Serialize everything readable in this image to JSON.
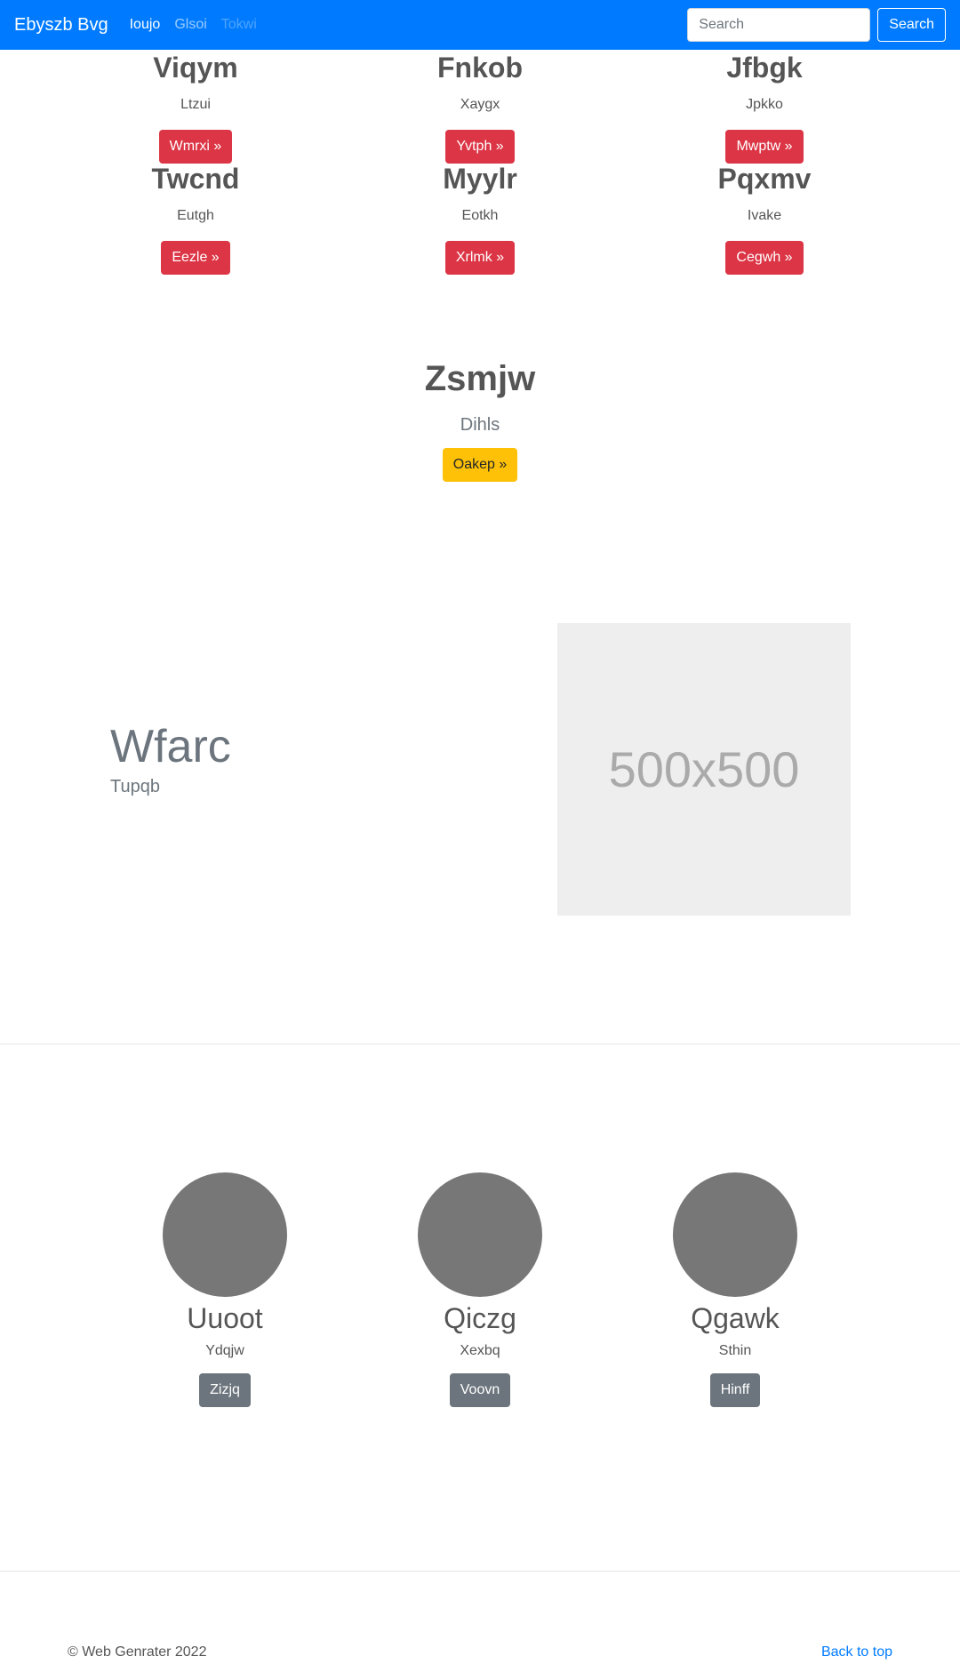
{
  "navbar": {
    "brand": "Ebyszb Bvg",
    "links": [
      {
        "label": "Ioujo",
        "state": "active"
      },
      {
        "label": "Glsoi",
        "state": "normal"
      },
      {
        "label": "Tokwi",
        "state": "disabled"
      }
    ],
    "search_placeholder": "Search",
    "search_button": "Search"
  },
  "products": [
    {
      "title": "Viqym",
      "subtitle": "Ltzui",
      "button": "Wmrxi »"
    },
    {
      "title": "Fnkob",
      "subtitle": "Xaygx",
      "button": "Yvtph »"
    },
    {
      "title": "Jfbgk",
      "subtitle": "Jpkko",
      "button": "Mwptw »"
    },
    {
      "title": "Twcnd",
      "subtitle": "Eutgh",
      "button": "Eezle »"
    },
    {
      "title": "Myylr",
      "subtitle": "Eotkh",
      "button": "Xrlmk »"
    },
    {
      "title": "Pqxmv",
      "subtitle": "Ivake",
      "button": "Cegwh »"
    }
  ],
  "feature": {
    "title": "Zsmjw",
    "subtitle": "Dihls",
    "button": "Oakep »"
  },
  "hero": {
    "title": "Wfarc",
    "subtitle": "Tupqb",
    "image_label": "500x500"
  },
  "team": [
    {
      "name": "Uuoot",
      "subtitle": "Ydqjw",
      "button": "Zizjq"
    },
    {
      "name": "Qiczg",
      "subtitle": "Xexbq",
      "button": "Voovn"
    },
    {
      "name": "Qgawk",
      "subtitle": "Sthin",
      "button": "Hinff"
    }
  ],
  "footer": {
    "copyright": "© Web Genrater 2022",
    "back_to_top": "Back to top"
  },
  "colors": {
    "primary": "#007bff",
    "danger": "#dc3545",
    "warning": "#ffc107",
    "secondary": "#6c757d"
  }
}
